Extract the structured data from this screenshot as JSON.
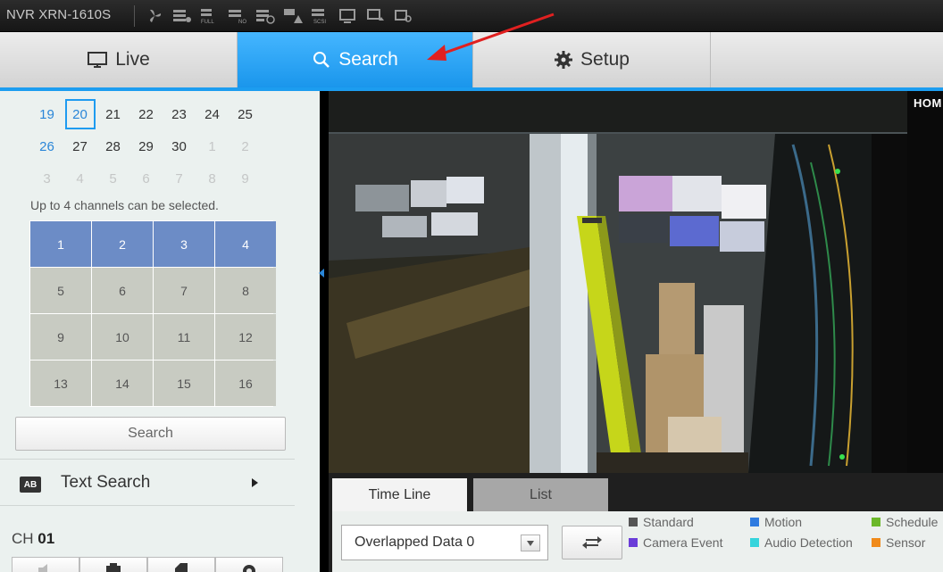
{
  "device": {
    "name": "NVR XRN-1610S"
  },
  "colors": {
    "accent": "#1c9df0",
    "selected_channel": "#6c8cc6",
    "annotation_arrow": "#e02020"
  },
  "status_icons": [
    "fan-icon",
    "record-icon",
    "full-icon",
    "hdd-icon",
    "schedule-record-icon",
    "record-alert-icon",
    "smart-search-icon",
    "network-monitor-icon",
    "network-output-icon",
    "remote-icon"
  ],
  "tabs": [
    {
      "label": "Live",
      "icon": "monitor-icon"
    },
    {
      "label": "Search",
      "icon": "search-icon",
      "active": true
    },
    {
      "label": "Setup",
      "icon": "gear-icon"
    }
  ],
  "calendar": {
    "weeks": [
      [
        "19",
        "20",
        "21",
        "22",
        "23",
        "24",
        "25"
      ],
      [
        "26",
        "27",
        "28",
        "29",
        "30",
        "1",
        "2"
      ],
      [
        "3",
        "4",
        "5",
        "6",
        "7",
        "8",
        "9"
      ]
    ],
    "selected_day": "20"
  },
  "channel_note": "Up to 4 channels can be selected.",
  "channels": {
    "labels": [
      "1",
      "2",
      "3",
      "4",
      "5",
      "6",
      "7",
      "8",
      "9",
      "10",
      "11",
      "12",
      "13",
      "14",
      "15",
      "16"
    ],
    "selected": [
      "1",
      "2",
      "3",
      "4"
    ]
  },
  "search_button": "Search",
  "text_search": {
    "badge": "AB",
    "label": "Text Search"
  },
  "channel_display": {
    "prefix": "CH",
    "number": "01"
  },
  "video": {
    "overlay": "HOM"
  },
  "bottom": {
    "tabs": [
      "Time Line",
      "List"
    ],
    "overlap_select": "Overlapped Data 0",
    "legend": [
      {
        "label": "Standard",
        "color": "#555555"
      },
      {
        "label": "Motion",
        "color": "#2f7be0"
      },
      {
        "label": "Schedule",
        "color": "#6cb82a"
      },
      {
        "label": "Camera Event",
        "color": "#6a3cd8"
      },
      {
        "label": "Audio Detection",
        "color": "#35d4dc"
      },
      {
        "label": "Sensor",
        "color": "#f08a1a"
      }
    ]
  }
}
